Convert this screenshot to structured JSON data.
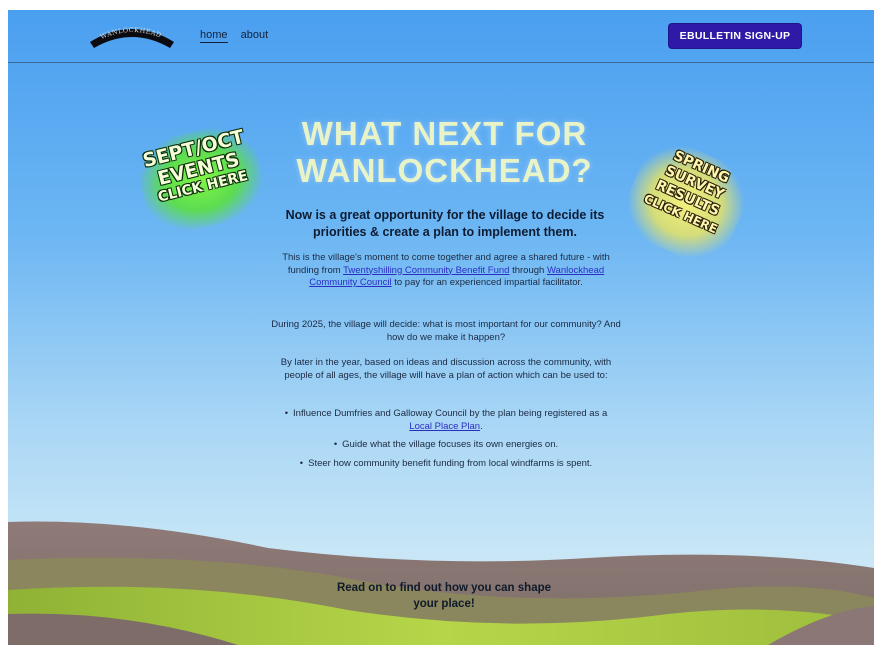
{
  "header": {
    "logo_text": "WANLOCKHEAD",
    "nav": [
      {
        "label": "home"
      },
      {
        "label": "about"
      }
    ],
    "signup_label": "EBULLETIN SIGN-UP"
  },
  "hero": {
    "title_line1": "WHAT NEXT FOR",
    "title_line2": "WANLOCKHEAD?",
    "subtitle_line1": "Now is a great opportunity for the village to decide its",
    "subtitle_line2": "priorities & create a plan to implement them."
  },
  "content": {
    "p1_part1": "This is the village's moment to come together and agree a shared future - with funding from ",
    "p1_link1": "Twentyshilling Community Benefit Fund",
    "p1_part2": " through ",
    "p1_link2": "Wanlockhead Community Council",
    "p1_part3": " to pay for an experienced impartial facilitator.",
    "p2": "During 2025, the village will decide: what is most important for our community? And how do we make it happen?",
    "p3": "By later in the year, based on ideas and discussion across the community, with people of all ages, the village will have a plan of action which can be used to:",
    "bullet_marker": "•",
    "bullet1_part1": "Influence Dumfries and Galloway Council by the plan being registered as a ",
    "bullet1_link": "Local Place Plan",
    "bullet1_part2": ".",
    "bullet2": "Guide what the village focuses its own energies on.",
    "bullet3": "Steer how community benefit funding from local windfarms is spent."
  },
  "cta": {
    "line1": "Read on to find out how you can shape",
    "line2": "your place!"
  },
  "sticker_events": {
    "line1": "SEPT/OCT",
    "line2": "EVENTS",
    "line3": "CLICK HERE"
  },
  "sticker_survey": {
    "line1": "SPRING",
    "line2": "SURVEY",
    "line3": "RESULTS",
    "line4": "CLICK HERE"
  },
  "colors": {
    "signup_button": "#2e1aa6",
    "link": "#2a2fc4",
    "title": "#e9f3c8",
    "sticker_events_glow": "#82fa3c",
    "sticker_survey_glow": "#faf578"
  }
}
